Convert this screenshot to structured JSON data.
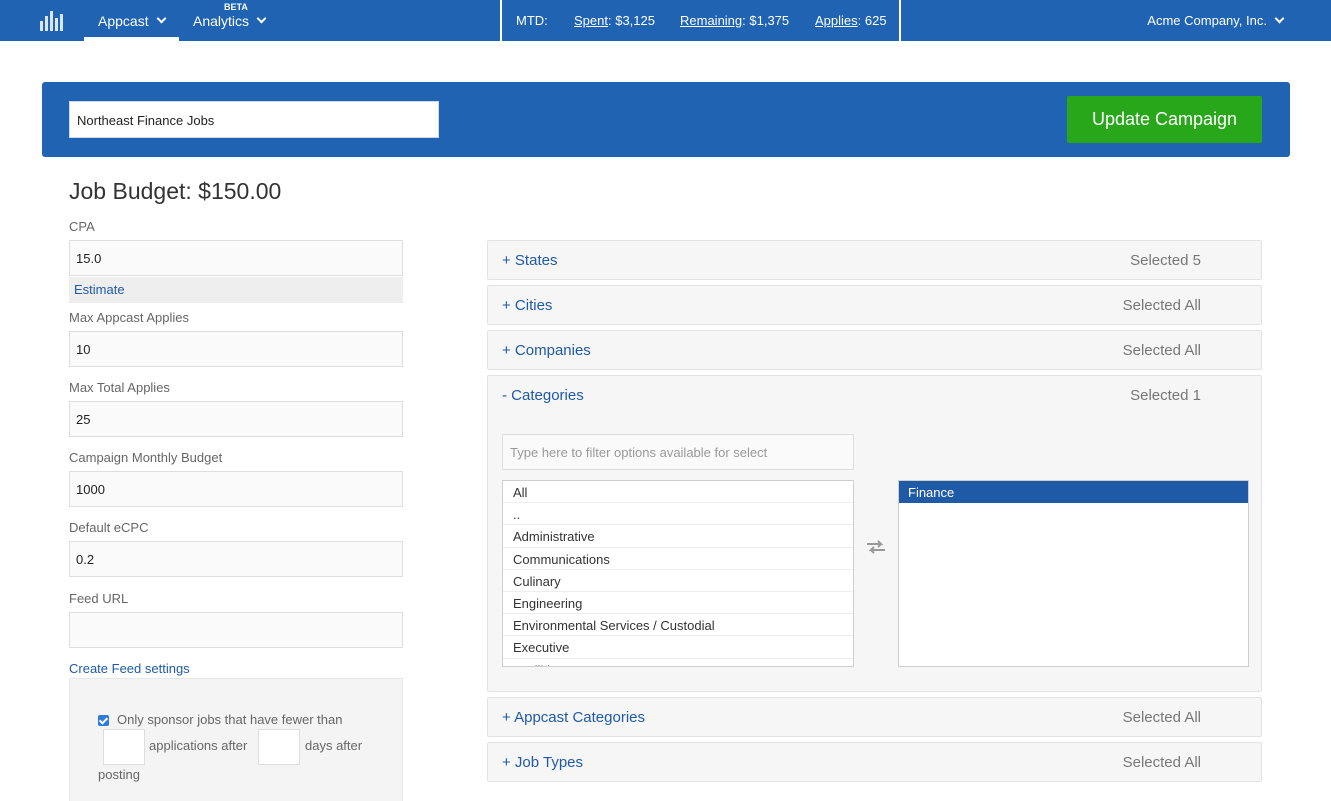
{
  "nav": {
    "appcast": "Appcast",
    "analytics": "Analytics",
    "beta": "BETA",
    "mtd_label": "MTD:",
    "spent_label": "Spent",
    "spent_value": ": $3,125",
    "remaining_label": "Remaining",
    "remaining_value": ": $1,375",
    "applies_label": "Applies",
    "applies_value": ": 625",
    "account": "Acme Company, Inc."
  },
  "campaign": {
    "name": "Northeast Finance  Jobs",
    "update_button": "Update Campaign"
  },
  "form": {
    "budget_title": "Job Budget: $150.00",
    "cpa_label": "CPA",
    "cpa_value": "15.0",
    "estimate_link": "Estimate",
    "max_appcast_label": "Max Appcast Applies",
    "max_appcast_value": "10",
    "max_total_label": "Max Total Applies",
    "max_total_value": "25",
    "monthly_budget_label": "Campaign Monthly Budget",
    "monthly_budget_value": "1000",
    "ecpc_label": "Default eCPC",
    "ecpc_value": "0.2",
    "feed_url_label": "Feed URL",
    "feed_url_value": "",
    "create_feed_link": "Create Feed settings",
    "sponsor_text": "Only sponsor jobs that have fewer than",
    "applications_after": "applications after",
    "days_after": "days after",
    "posting": "posting"
  },
  "filters": {
    "states": {
      "title": "+ States",
      "selected": "Selected 5"
    },
    "cities": {
      "title": "+ Cities",
      "selected": "Selected All"
    },
    "companies": {
      "title": "+ Companies",
      "selected": "Selected All"
    },
    "categories": {
      "title": "- Categories",
      "selected": "Selected 1",
      "filter_placeholder": "Type here to filter options available for select",
      "available": [
        "All",
        "..",
        "Administrative",
        "Communications",
        "Culinary",
        "Engineering",
        "Environmental Services / Custodial",
        "Executive",
        "Facilities"
      ],
      "chosen": [
        "Finance"
      ]
    },
    "appcast_categories": {
      "title": "+ Appcast Categories",
      "selected": "Selected All"
    },
    "job_types": {
      "title": "+ Job Types",
      "selected": "Selected All"
    }
  }
}
